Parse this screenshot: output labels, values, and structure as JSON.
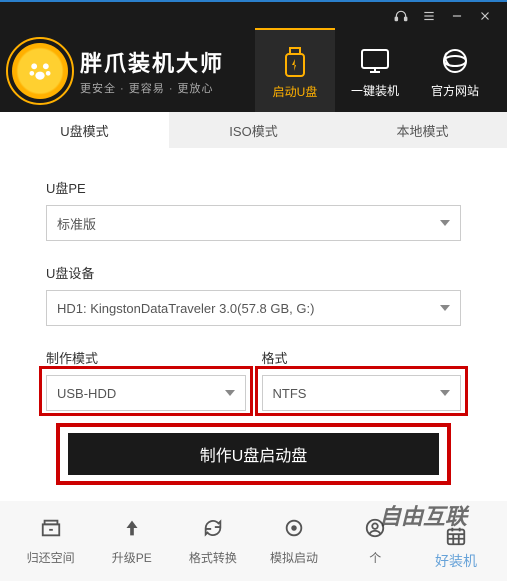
{
  "titlebar": {
    "headset_icon": "headset-icon",
    "menu_icon": "menu-icon",
    "minimize_icon": "minimize-icon",
    "close_icon": "close-icon"
  },
  "brand": {
    "title": "胖爪装机大师",
    "subtitle": "更安全 · 更容易 · 更放心"
  },
  "nav": [
    {
      "label": "启动U盘",
      "icon": "usb-bolt",
      "active": true
    },
    {
      "label": "一键装机",
      "icon": "monitor",
      "active": false
    },
    {
      "label": "官方网站",
      "icon": "globe-ie",
      "active": false
    }
  ],
  "subtabs": [
    {
      "label": "U盘模式",
      "active": true
    },
    {
      "label": "ISO模式",
      "active": false
    },
    {
      "label": "本地模式",
      "active": false
    }
  ],
  "form": {
    "upe_label": "U盘PE",
    "upe_value": "标准版",
    "device_label": "U盘设备",
    "device_value": "HD1: KingstonDataTraveler 3.0(57.8 GB, G:)",
    "mode_label": "制作模式",
    "mode_value": "USB-HDD",
    "format_label": "格式",
    "format_value": "NTFS",
    "make_button": "制作U盘启动盘"
  },
  "footer": [
    {
      "label": "归还空间",
      "icon": "archive-box"
    },
    {
      "label": "升级PE",
      "icon": "arrow-up"
    },
    {
      "label": "格式转换",
      "icon": "refresh"
    },
    {
      "label": "模拟启动",
      "icon": "target"
    },
    {
      "label": "个",
      "icon": "globe-user"
    },
    {
      "label": "",
      "icon": "calendar"
    }
  ],
  "watermarks": {
    "w1": "自由互联",
    "w2": "好装机"
  },
  "colors": {
    "accent": "#ffb000",
    "dark": "#1a1a1a",
    "highlight": "#c00"
  }
}
